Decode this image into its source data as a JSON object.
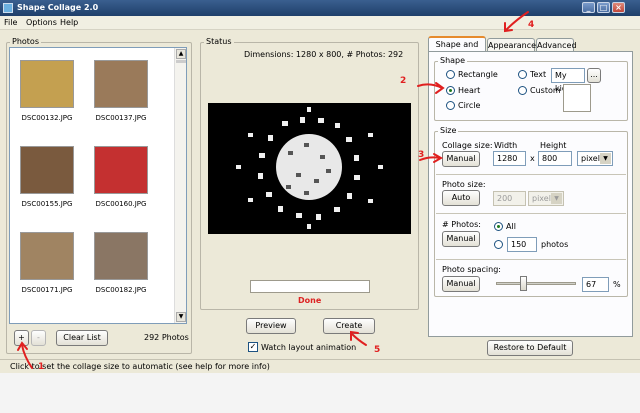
{
  "window": {
    "title": "Shape Collage 2.0"
  },
  "menu": {
    "file": "File",
    "options": "Options",
    "help": "Help"
  },
  "photos": {
    "group_label": "Photos",
    "items": [
      {
        "name": "DSC00132.JPG",
        "color": "#c4a050"
      },
      {
        "name": "DSC00137.JPG",
        "color": "#9a7a5a"
      },
      {
        "name": "DSC00155.JPG",
        "color": "#7a5a3e"
      },
      {
        "name": "DSC00160.JPG",
        "color": "#c43030"
      },
      {
        "name": "DSC00171.JPG",
        "color": "#a08462"
      },
      {
        "name": "DSC00182.JPG",
        "color": "#8a7664"
      }
    ],
    "add_label": "+",
    "remove_label": "-",
    "clear_label": "Clear List",
    "count": "292 Photos"
  },
  "status": {
    "group_label": "Status",
    "info": "Dimensions: 1280 x 800, # Photos: 292",
    "done": "Done",
    "preview_label": "Preview",
    "create_label": "Create",
    "watch_label": "Watch layout animation",
    "watch_checked": true
  },
  "tabs": {
    "shape_size": "Shape and Size",
    "appearance": "Appearance",
    "advanced": "Advanced"
  },
  "shape": {
    "group_label": "Shape",
    "rectangle": "Rectangle",
    "heart": "Heart",
    "circle": "Circle",
    "text": "Text",
    "text_value": "My kids",
    "browse": "...",
    "custom": "Custom",
    "selected": "heart"
  },
  "size": {
    "group_label": "Size",
    "collage_size_label": "Collage size:",
    "manual": "Manual",
    "auto": "Auto",
    "width_label": "Width",
    "height_label": "Height",
    "width": "1280",
    "x": "x",
    "height": "800",
    "unit": "pixels",
    "photo_size_label": "Photo size:",
    "photo_size_value": "200",
    "photo_size_unit": "pixels",
    "num_photos_label": "# Photos:",
    "all": "All",
    "num_value": "150",
    "num_unit": "photos",
    "spacing_label": "Photo spacing:",
    "spacing_value": "67",
    "spacing_level": 0.67,
    "percent": "%"
  },
  "restore_label": "Restore to Default",
  "statusbar": "Click to set the collage size to automatic (see help for more info)",
  "annotations": {
    "a1": "1",
    "a2": "2",
    "a3": "3",
    "a4": "4",
    "a5": "5"
  }
}
